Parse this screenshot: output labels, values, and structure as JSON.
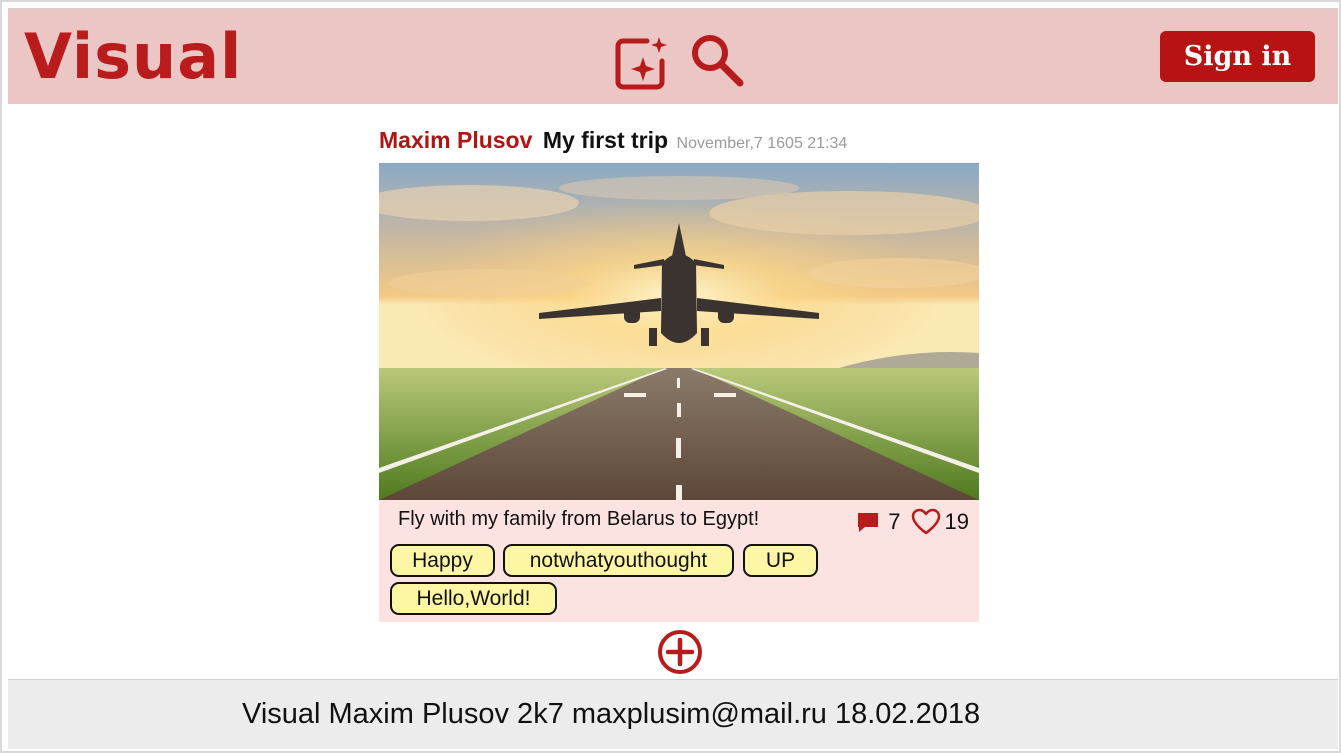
{
  "header": {
    "logo": "Visual",
    "signin_label": "Sign in",
    "icons": [
      "add-photo-sparkle-icon",
      "search-icon"
    ],
    "accent_color": "#b71313",
    "background_color": "#ecc5c5"
  },
  "post": {
    "author": "Maxim Plusov",
    "title": "My first trip",
    "date": "November,7 1605 21:34",
    "image_description_icon": "airplane-runway-photo",
    "description": "Fly with my family from Belarus to Egypt!",
    "comments": "7",
    "likes": "19",
    "tags": [
      "Happy",
      "notwhatyouthought",
      "UP",
      "Hello,World!"
    ],
    "panel_color": "#fde2e2",
    "tag_color": "#fdf7a5"
  },
  "actions": {
    "add_icon": "plus-circle-icon"
  },
  "footer": {
    "text": "Visual Maxim Plusov 2k7 maxplusim@mail.ru 18.02.2018"
  }
}
